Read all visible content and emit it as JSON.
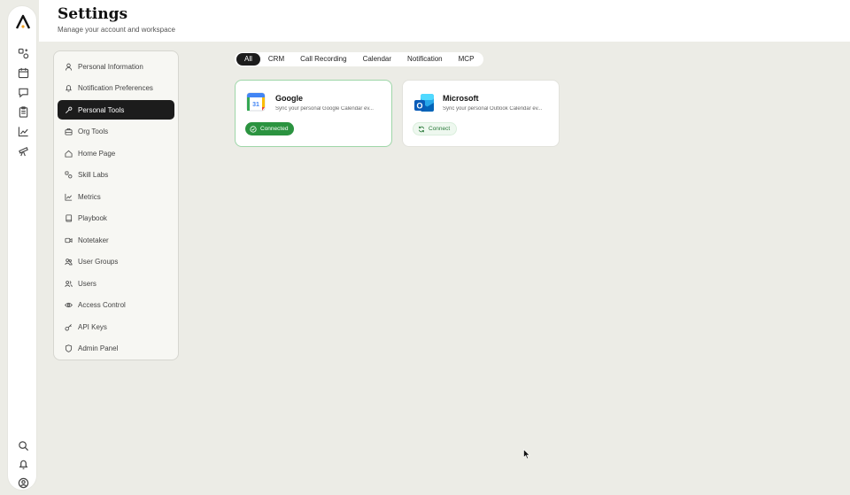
{
  "header": {
    "title": "Settings",
    "subtitle": "Manage your account and workspace"
  },
  "rail": {
    "top_icons": [
      "logo-icon",
      "skills-icon",
      "calendar-icon",
      "chat-icon",
      "clipboard-icon",
      "metrics-icon",
      "telescope-icon"
    ],
    "bottom_icons": [
      "search-icon",
      "bell-icon",
      "user-circle-icon"
    ]
  },
  "settings_nav": {
    "items": [
      {
        "label": "Personal Information",
        "icon": "user-icon",
        "active": false
      },
      {
        "label": "Notification Preferences",
        "icon": "bell-icon",
        "active": false
      },
      {
        "label": "Personal Tools",
        "icon": "wrench-icon",
        "active": true
      },
      {
        "label": "Org Tools",
        "icon": "toolbox-icon",
        "active": false
      },
      {
        "label": "Home Page",
        "icon": "home-icon",
        "active": false
      },
      {
        "label": "Skill Labs",
        "icon": "skills-icon",
        "active": false
      },
      {
        "label": "Metrics",
        "icon": "chart-line-icon",
        "active": false
      },
      {
        "label": "Playbook",
        "icon": "book-icon",
        "active": false
      },
      {
        "label": "Notetaker",
        "icon": "video-icon",
        "active": false
      },
      {
        "label": "User Groups",
        "icon": "users-group-icon",
        "active": false
      },
      {
        "label": "Users",
        "icon": "users-icon",
        "active": false
      },
      {
        "label": "Access Control",
        "icon": "eye-icon",
        "active": false
      },
      {
        "label": "API Keys",
        "icon": "key-icon",
        "active": false
      },
      {
        "label": "Admin Panel",
        "icon": "shield-icon",
        "active": false
      }
    ]
  },
  "filters": {
    "items": [
      {
        "label": "All",
        "active": true
      },
      {
        "label": "CRM",
        "active": false
      },
      {
        "label": "Call Recording",
        "active": false
      },
      {
        "label": "Calendar",
        "active": false
      },
      {
        "label": "Notification",
        "active": false
      },
      {
        "label": "MCP",
        "active": false
      }
    ]
  },
  "integrations": [
    {
      "name": "Google",
      "description": "Sync your personal Google Calendar ev...",
      "status": "Connected",
      "connected": true,
      "icon": "google-calendar-icon",
      "icon_text": "31"
    },
    {
      "name": "Microsoft",
      "description": "Sync your personal Outlook Calendar ev...",
      "status": "Connect",
      "connected": false,
      "icon": "outlook-icon",
      "icon_text": "O"
    }
  ],
  "colors": {
    "accent_dark": "#1c1c1c",
    "connected_green": "#2b9340",
    "background": "#ecece6"
  }
}
